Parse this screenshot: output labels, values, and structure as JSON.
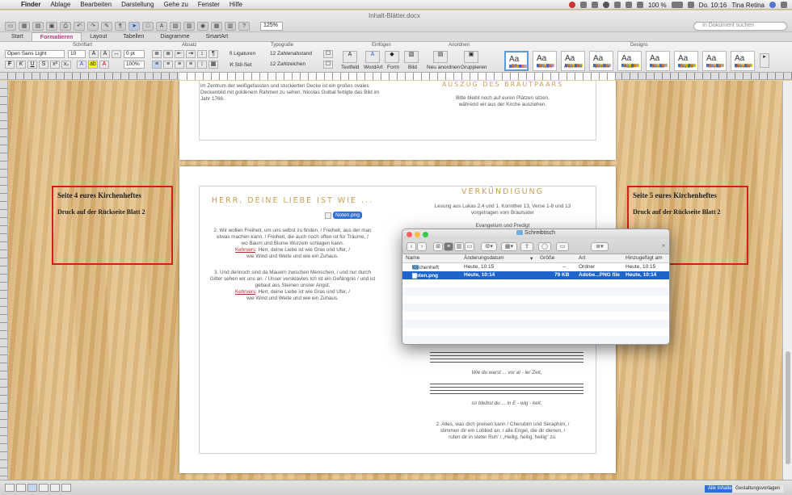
{
  "menubar": {
    "apple": "",
    "items": [
      "Finder",
      "Ablage",
      "Bearbeiten",
      "Darstellung",
      "Gehe zu",
      "Fenster",
      "Hilfe"
    ],
    "battery": "100 %",
    "clock": "Do. 10:16",
    "user": "Tina Retina"
  },
  "word": {
    "doc_title": "Inhalt-Blätter.docx",
    "zoom": "125%",
    "search_placeholder": "In Dokument suchen",
    "tabs": [
      "Start",
      "Formatieren",
      "Layout",
      "Tabellen",
      "Diagramme",
      "SmartArt"
    ],
    "active_tab": "Formatieren",
    "groups": {
      "schrift": "Schriftart",
      "absatz": "Absatz",
      "typografie": "Typografie",
      "einfuegen": "Einfügen",
      "anordnen": "Anordnen",
      "designs": "Designs"
    },
    "font_name": "Open Sans Light",
    "font_size": "10",
    "spacing": "0 pt",
    "scale": "100%",
    "typo": {
      "ligaturen": "Ligaturen",
      "zahlenabstand": "Zahlenabstand",
      "stilset": "Stil-Set",
      "zahlzeichen": "Zahlzeichen"
    },
    "insert": [
      "Textfeld",
      "WordArt",
      "Form",
      "Bild"
    ],
    "arrange": [
      "Neu anordnen",
      "Gruppieren"
    ],
    "designs": [
      "Office",
      "Schwarz",
      "Amphitrite",
      "Apotheke",
      "Austin",
      "Boreas",
      "Couture",
      "Cronus",
      "Demeter"
    ],
    "status_tabs": [
      "Alle Inhalte",
      "Gestaltungsvorlagen"
    ]
  },
  "page1": {
    "left_text": "im Zentrum der weißgefassten und stuckierten Decke ist ein großes ovales Deckenbild mit goldenem Rahmen zu sehen. Nicolas Guibal fertigte das Bild im Jahr 1766.",
    "right_title": "AUSZUG DES BRAUTPAARS",
    "right_text1": "Bitte bleibt noch auf euren Plätzen sitzen,",
    "right_text2": "während wir aus der Kirche ausziehen."
  },
  "page2": {
    "left_title": "HERR, DEINE LIEBE IST WIE ...",
    "notes_chip": "Noten.png",
    "verse2": [
      "2. Wir wollen Freiheit, um uns selbst zu finden, / Freiheit, aus der man",
      "etwas machen kann. / Freiheit, die auch noch offen ist für Träume, /",
      "wo Baum und Blume Wurzeln schlagen kann."
    ],
    "refrain_label": "Kehrvers",
    "refrain_line1": ": Herr, deine Liebe ist wie Gras und Ufer, /",
    "refrain_line2": "wie Wind und Weite und wie ein Zuhaus.",
    "verse3": [
      "3. Und dennoch sind da Mauern zwischen Menschen, / und nur durch",
      "Gitter sehen wir uns an. / Unser versklavtes Ich ist ein Gefängnis / und ist",
      "gebaut aus Steinen unsrer Angst."
    ],
    "right_title": "VERKÜNDIGUNG",
    "lesung1": "Lesung aus Lukas 2,4 und 1. Korinther 13, Verse 1-8 und 13",
    "lesung2": "vorgetragen vom Brautvater",
    "evangelium": "Evangelium und Predigt",
    "music_lyrics1": "Wie   du   warst   ...   vor   al  -  ler   Zeit,",
    "music_lyrics2": "so   bleibst   du   ...   in   E  -  wig  -  keit.",
    "verse_end": [
      "2. Alles, was dich preisen kann / Cherubim und Seraphim, /",
      "stimmen dir ein Loblied an; / alle Engel, die dir dienen, /",
      "rufen dir in steter Ruh' / „Heilig, heilig, heilig\" zu."
    ]
  },
  "annotations": {
    "left_box_title": "Seite 4 eures Kirchenheftes",
    "left_box_sub": "Druck auf der Rückseite Blatt 2",
    "right_box_title": "Seite 5 eures Kirchenheftes",
    "right_box_sub": "Druck auf der Rückseite Blatt 2"
  },
  "finder": {
    "title": "Schreibtisch",
    "columns": [
      "Name",
      "Änderungsdatum",
      "Größe",
      "Art",
      "Hinzugefügt am"
    ],
    "rows": [
      {
        "name": "Kirchenheft",
        "date": "Heute, 10:15",
        "size": "--",
        "kind": "Ordner",
        "added": "Heute, 10:15",
        "selected": false
      },
      {
        "name": "Noten.png",
        "date": "Heute, 10:14",
        "size": "79 KB",
        "kind": "Adobe...PNG file",
        "added": "Heute, 10:14",
        "selected": true
      }
    ]
  },
  "colors": {
    "accent_tab": "#b04080",
    "selection": "#1f64c9",
    "annotation_red": "#d41d1d",
    "title_gold": "#c8a050"
  }
}
